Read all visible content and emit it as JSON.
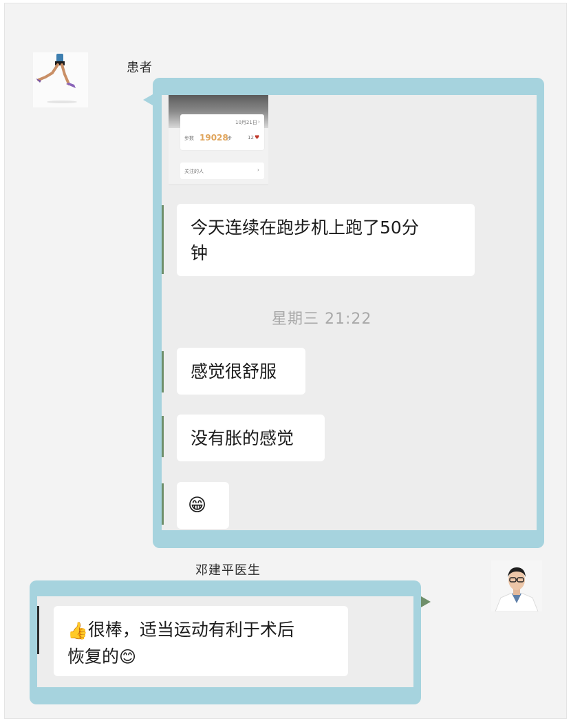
{
  "patient": {
    "name": "患者",
    "step_screenshot": {
      "date": "10月21日",
      "steps_label": "步数",
      "steps_value": "19028",
      "steps_unit": "步",
      "likes": "12",
      "follow_label": "关注的人"
    },
    "messages": [
      {
        "text_line1": "今天连续在跑步机上跑了50分",
        "text_line2": "钟"
      },
      {
        "text": "感觉很舒服"
      },
      {
        "text": "没有胀的感觉"
      },
      {
        "emoji": "😁"
      }
    ],
    "timestamp": "星期三 21:22"
  },
  "doctor": {
    "name": "邓建平医生",
    "message": {
      "emoji_start": "👍",
      "line1": "很棒，适当运动有利于术后",
      "line2": "恢复的",
      "emoji_end": "😊"
    }
  },
  "colors": {
    "frame_teal": "#a6d3de",
    "chat_bg": "#ededed",
    "bubble": "#ffffff",
    "timestamp": "#a8a8a8"
  }
}
